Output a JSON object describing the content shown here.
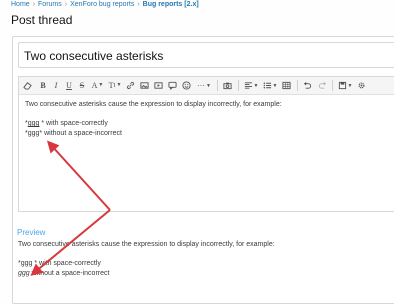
{
  "breadcrumb": {
    "items": [
      "Home",
      "Forums",
      "XenForo bug reports",
      "Bug reports [2.x]"
    ],
    "separator": "›"
  },
  "page": {
    "title": "Post thread"
  },
  "thread_title": {
    "value": "Two consecutive asterisks"
  },
  "toolbar": {
    "buttons": [
      {
        "name": "eraser-icon"
      },
      {
        "name": "bold-icon"
      },
      {
        "name": "italic-icon"
      },
      {
        "name": "underline-icon"
      },
      {
        "name": "strikethrough-icon"
      },
      {
        "name": "text-color-icon"
      },
      {
        "name": "font-size-icon"
      },
      {
        "name": "link-icon"
      },
      {
        "name": "image-icon"
      },
      {
        "name": "media-icon"
      },
      {
        "name": "quote-icon"
      },
      {
        "name": "smilie-icon"
      },
      {
        "name": "more-icon"
      },
      {
        "name": "camera-icon"
      },
      {
        "name": "align-icon"
      },
      {
        "name": "list-icon"
      },
      {
        "name": "table-icon"
      },
      {
        "name": "undo-icon"
      },
      {
        "name": "redo-icon"
      },
      {
        "name": "drafts-icon"
      },
      {
        "name": "settings-icon"
      }
    ]
  },
  "editor": {
    "line1": "Two consecutive asterisks cause the expression to display incorrectly, for example:",
    "line3a_prefix": "*",
    "line3a_word": "ggg",
    "line3a_rest": " * with space-correctly",
    "line3b_prefix": "*",
    "line3b_word": "ggg",
    "line3b_rest": "* without a space-incorrect"
  },
  "preview": {
    "label": "Preview",
    "line1": "Two consecutive asterisks cause the expression to display incorrectly, for example:",
    "line3a": "*ggg * with space-correctly",
    "line3b_italic": "ggg",
    "line3b_rest": " without a space-incorrect"
  },
  "colors": {
    "link": "#2577b1",
    "preview_label": "#47a7eb",
    "arrow": "#d9363e"
  }
}
